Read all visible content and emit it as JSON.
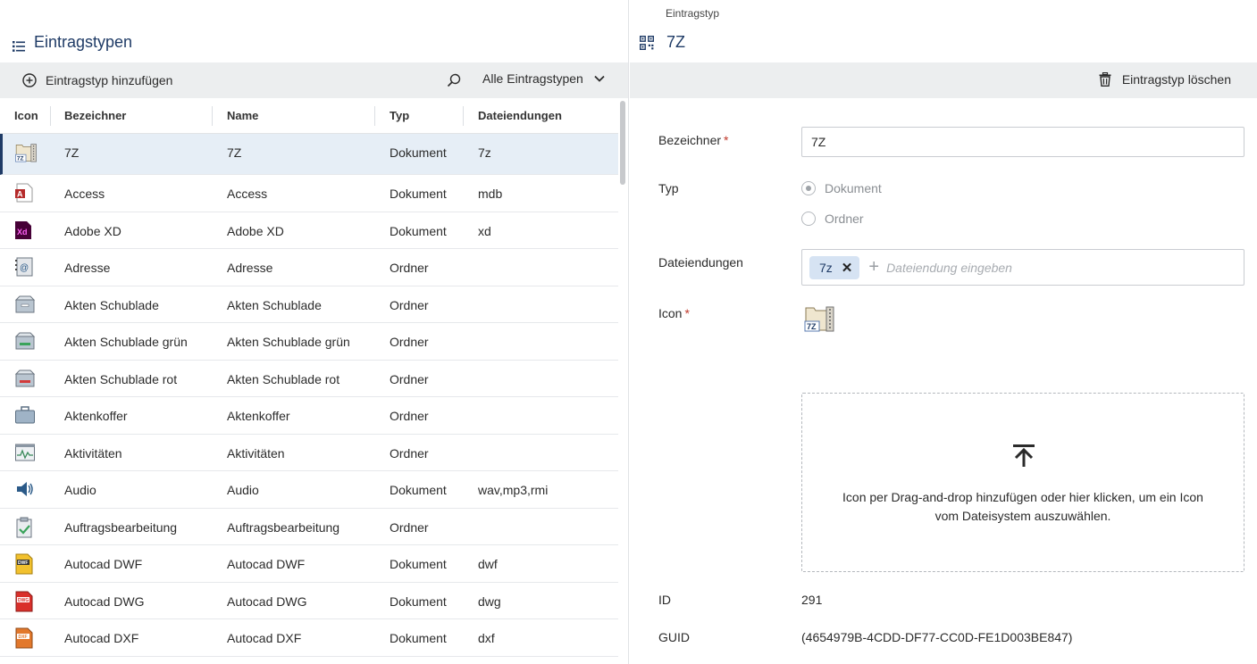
{
  "left_panel": {
    "title": "Eintragstypen",
    "add_label": "Eintragstyp hinzufügen",
    "filter_label": "Alle Eintragstypen",
    "columns": {
      "icon": "Icon",
      "bezeichner": "Bezeichner",
      "name": "Name",
      "typ": "Typ",
      "endungen": "Dateiendungen"
    },
    "rows": [
      {
        "bezeichner": "7Z",
        "name": "7Z",
        "typ": "Dokument",
        "endungen": "7z",
        "icon": "archive-7z-icon",
        "selected": true
      },
      {
        "bezeichner": "Access",
        "name": "Access",
        "typ": "Dokument",
        "endungen": "mdb",
        "icon": "access-icon"
      },
      {
        "bezeichner": "Adobe XD",
        "name": "Adobe XD",
        "typ": "Dokument",
        "endungen": "xd",
        "icon": "adobe-xd-icon"
      },
      {
        "bezeichner": "Adresse",
        "name": "Adresse",
        "typ": "Ordner",
        "endungen": "",
        "icon": "address-book-icon"
      },
      {
        "bezeichner": "Akten Schublade",
        "name": "Akten Schublade",
        "typ": "Ordner",
        "endungen": "",
        "icon": "drawer-icon"
      },
      {
        "bezeichner": "Akten Schublade grün",
        "name": "Akten Schublade grün",
        "typ": "Ordner",
        "endungen": "",
        "icon": "drawer-green-icon"
      },
      {
        "bezeichner": "Akten Schublade rot",
        "name": "Akten Schublade rot",
        "typ": "Ordner",
        "endungen": "",
        "icon": "drawer-red-icon"
      },
      {
        "bezeichner": "Aktenkoffer",
        "name": "Aktenkoffer",
        "typ": "Ordner",
        "endungen": "",
        "icon": "briefcase-icon"
      },
      {
        "bezeichner": "Aktivitäten",
        "name": "Aktivitäten",
        "typ": "Ordner",
        "endungen": "",
        "icon": "activity-icon"
      },
      {
        "bezeichner": "Audio",
        "name": "Audio",
        "typ": "Dokument",
        "endungen": "wav,mp3,rmi",
        "icon": "audio-icon"
      },
      {
        "bezeichner": "Auftragsbearbeitung",
        "name": "Auftragsbearbeitung",
        "typ": "Ordner",
        "endungen": "",
        "icon": "clipboard-check-icon"
      },
      {
        "bezeichner": "Autocad DWF",
        "name": "Autocad DWF",
        "typ": "Dokument",
        "endungen": "dwf",
        "icon": "dwf-icon"
      },
      {
        "bezeichner": "Autocad DWG",
        "name": "Autocad DWG",
        "typ": "Dokument",
        "endungen": "dwg",
        "icon": "dwg-icon"
      },
      {
        "bezeichner": "Autocad DXF",
        "name": "Autocad DXF",
        "typ": "Dokument",
        "endungen": "dxf",
        "icon": "dxf-icon"
      }
    ]
  },
  "right_panel": {
    "caption": "Eintragstyp",
    "title": "7Z",
    "delete_label": "Eintragstyp löschen",
    "bezeichner_label": "Bezeichner",
    "bezeichner_value": "7Z",
    "required_mark": "*",
    "typ_label": "Typ",
    "typ_options": [
      "Dokument",
      "Ordner"
    ],
    "typ_selected": "Dokument",
    "endungen_label": "Dateiendungen",
    "endungen_tags": [
      "7z"
    ],
    "endungen_placeholder": "Dateiendung eingeben",
    "icon_label": "Icon",
    "drop_text": "Icon per Drag-and-drop hinzufügen oder hier klicken, um ein Icon vom Dateisystem auszuwählen.",
    "id_label": "ID",
    "id_value": "291",
    "guid_label": "GUID",
    "guid_value": "(4654979B-4CDD-DF77-CC0D-FE1D003BE847)"
  },
  "colors": {
    "accent": "#1f3b66",
    "toolbar_bg": "#eceeef",
    "selected_row": "#e6eef6",
    "tag_bg": "#d6e3f3"
  }
}
